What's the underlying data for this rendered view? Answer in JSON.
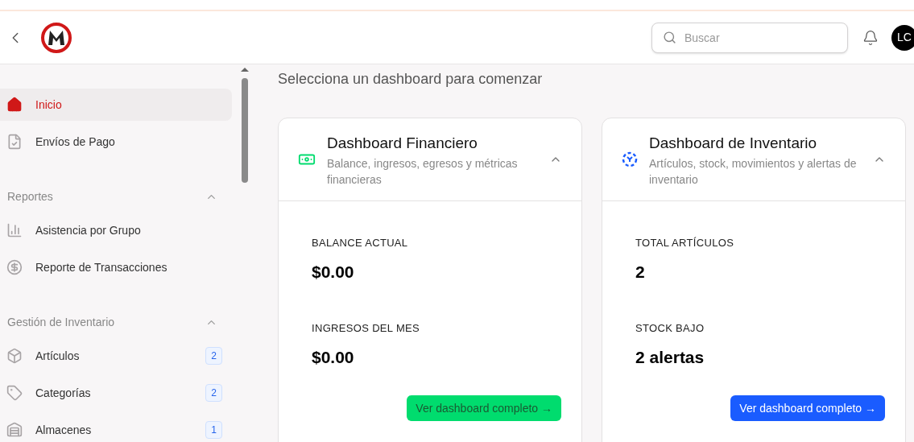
{
  "header": {
    "search": {
      "placeholder": "Buscar"
    },
    "avatar": "LC"
  },
  "sidebar": {
    "items": [
      {
        "label": "Inicio",
        "kind": "home",
        "selected": true
      },
      {
        "label": "Envíos de Pago",
        "kind": "file",
        "selected": false
      }
    ],
    "sections": [
      {
        "title": "Reportes",
        "expanded": true,
        "items": [
          {
            "label": "Asistencia por Grupo",
            "kind": "chart",
            "selected": false
          },
          {
            "label": "Reporte de Transacciones",
            "kind": "dollar",
            "selected": false
          }
        ]
      },
      {
        "title": "Gestión de Inventario",
        "expanded": true,
        "items": [
          {
            "label": "Artículos",
            "kind": "box",
            "selected": false,
            "count": "2"
          },
          {
            "label": "Categorías",
            "kind": "tag",
            "selected": false,
            "count": "2"
          },
          {
            "label": "Almacenes",
            "kind": "warehouse",
            "selected": false,
            "count": "1"
          }
        ]
      }
    ]
  },
  "main": {
    "heading": "Selecciona un dashboard para comenzar",
    "cards": [
      {
        "kind": "finance",
        "title": "Dashboard Financiero",
        "description": "Balance, ingresos, egresos y métricas financieras",
        "expanded": true,
        "color": "#00dc6e",
        "metrics": [
          {
            "label": "BALANCE ACTUAL",
            "value": "$0.00"
          },
          {
            "label": "INGRESOS DEL MES",
            "value": "$0.00"
          }
        ],
        "button": "Ver dashboard completo →"
      },
      {
        "kind": "inventory",
        "title": "Dashboard de Inventario",
        "description": "Artículos, stock, movimientos y alertas de inventario",
        "expanded": true,
        "color": "#1a5cff",
        "metrics": [
          {
            "label": "TOTAL ARTÍCULOS",
            "value": "2"
          },
          {
            "label": "STOCK BAJO",
            "value": "2 alertas"
          }
        ],
        "button": "Ver dashboard completo →"
      }
    ]
  }
}
